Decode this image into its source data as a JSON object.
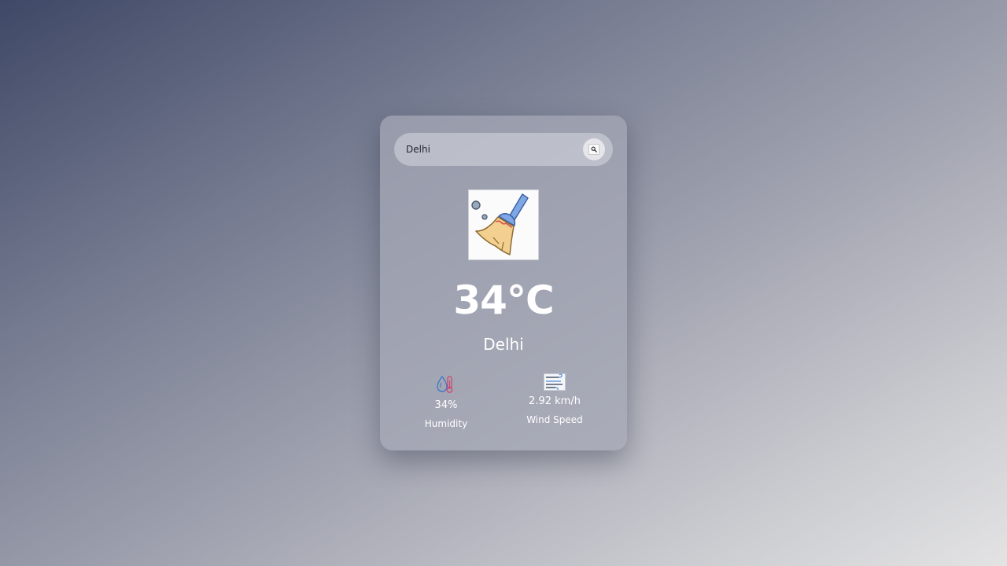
{
  "search": {
    "value": "Delhi",
    "button_icon": "search-icon"
  },
  "weather": {
    "icon": "broom-icon",
    "temperature": "34°C",
    "city": "Delhi"
  },
  "details": {
    "humidity": {
      "icon": "humidity-icon",
      "value": "34%",
      "label": "Humidity"
    },
    "wind": {
      "icon": "wind-icon",
      "value": "2.92 km/h",
      "label": "Wind Speed"
    }
  }
}
